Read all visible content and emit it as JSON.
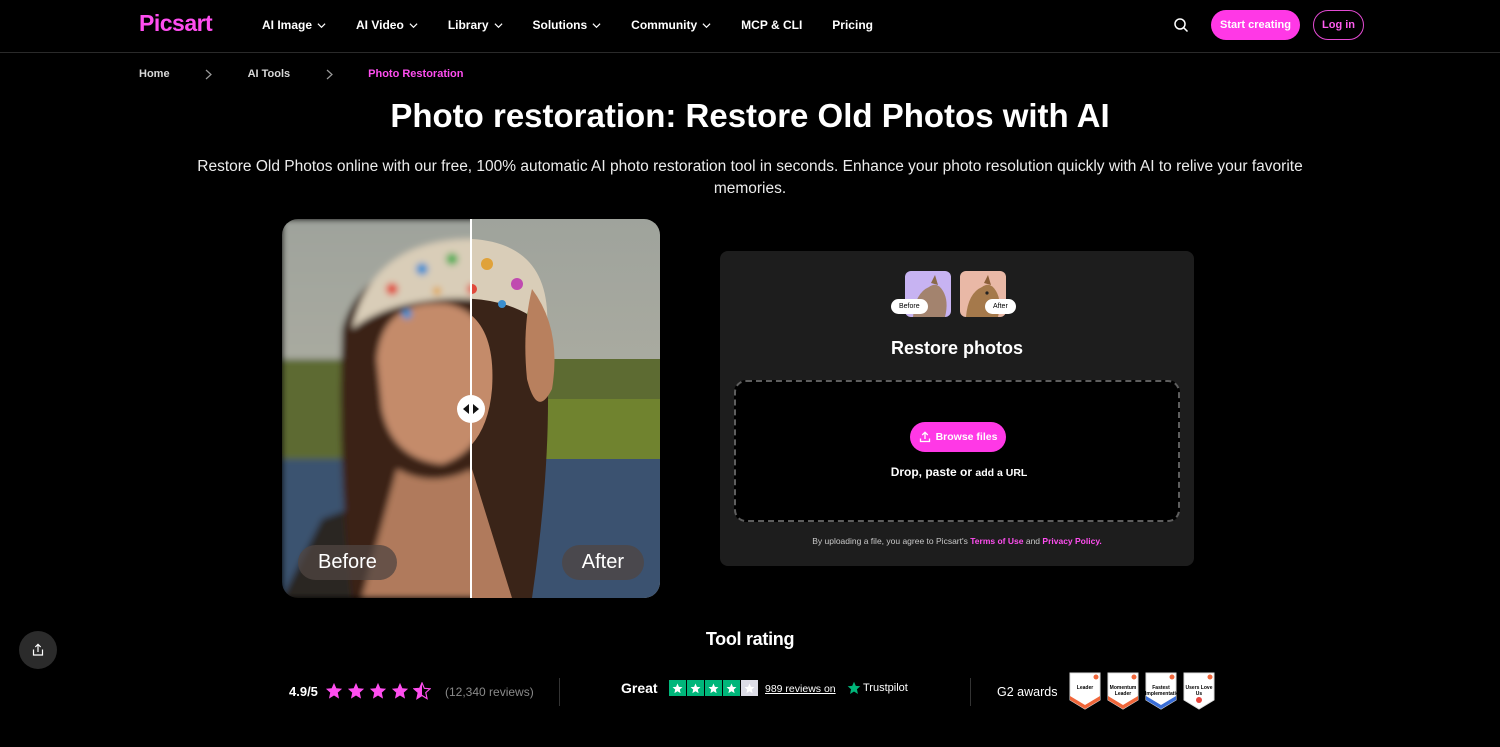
{
  "header": {
    "logo": "Picsart",
    "nav": [
      {
        "label": "AI Image",
        "dropdown": true
      },
      {
        "label": "AI Video",
        "dropdown": true
      },
      {
        "label": "Library",
        "dropdown": true
      },
      {
        "label": "Solutions",
        "dropdown": true
      },
      {
        "label": "Community",
        "dropdown": true
      },
      {
        "label": "MCP & CLI",
        "dropdown": false
      },
      {
        "label": "Pricing",
        "dropdown": false
      }
    ],
    "search_icon": "search-icon",
    "start_label": "Start creating",
    "login_label": "Log in"
  },
  "breadcrumb": {
    "items": [
      "Home",
      "AI Tools",
      "Photo Restoration"
    ]
  },
  "hero": {
    "title": "Photo restoration: Restore Old Photos with AI",
    "subtitle": "Restore Old Photos online with our free, 100% automatic AI photo restoration tool in seconds. Enhance your photo resolution quickly with AI to relive your favorite memories."
  },
  "compare": {
    "before_label": "Before",
    "after_label": "After",
    "handle_icon": "drag-arrows-icon"
  },
  "upload": {
    "thumb_before": "Before",
    "thumb_after": "After",
    "title": "Restore photos",
    "browse_label": "Browse files",
    "drop_text": "Drop, paste or",
    "url_text": "add a URL",
    "legal_prefix": "By uploading a file, you agree to Picsart's",
    "terms": "Terms of Use",
    "and": "and",
    "privacy": "Privacy Policy."
  },
  "rating": {
    "title": "Tool rating",
    "score": "4.9/5",
    "stars": 4.5,
    "reviews": "(12,340 reviews)",
    "trustpilot_label": "Great",
    "trustpilot_stars": 4,
    "trustpilot_reviews": "989 reviews on",
    "trustpilot_brand": "Trustpilot",
    "g2_label": "G2 awards",
    "badges": [
      {
        "label": "Leader",
        "color": "#f0663a"
      },
      {
        "label": "Momentum Leader",
        "color": "#f0663a"
      },
      {
        "label": "Fastest Implementation",
        "color": "#3b6fd8"
      },
      {
        "label": "Users Love Us",
        "color": "#e8453c"
      }
    ]
  },
  "colors": {
    "accent": "#ff38e6",
    "background": "#000000",
    "card": "#1d1d1d",
    "star": "#ff4ef0",
    "trustpilot": "#00b67a"
  }
}
